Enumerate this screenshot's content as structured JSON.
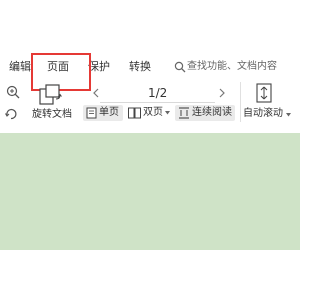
{
  "menu": {
    "tabs": [
      {
        "label": "编辑"
      },
      {
        "label": "页面"
      },
      {
        "label": "保护"
      },
      {
        "label": "转换"
      }
    ],
    "search_placeholder": "查找功能、文档内容"
  },
  "toolbar": {
    "rotate_label": "旋转文档",
    "page_indicator": "1/2",
    "single_page_label": "单页",
    "double_page_label": "双页",
    "continuous_label": "连续阅读",
    "auto_scroll_label": "自动滚动"
  },
  "colors": {
    "highlight": "#e53935",
    "content_bg": "#cfe3c7"
  },
  "icons": [
    "search-icon",
    "zoom-in-icon",
    "rotate-icon",
    "rotate-document-icon",
    "page-prev-icon",
    "page-next-icon",
    "single-page-icon",
    "double-page-icon",
    "continuous-icon",
    "auto-scroll-icon",
    "dropdown-icon"
  ]
}
